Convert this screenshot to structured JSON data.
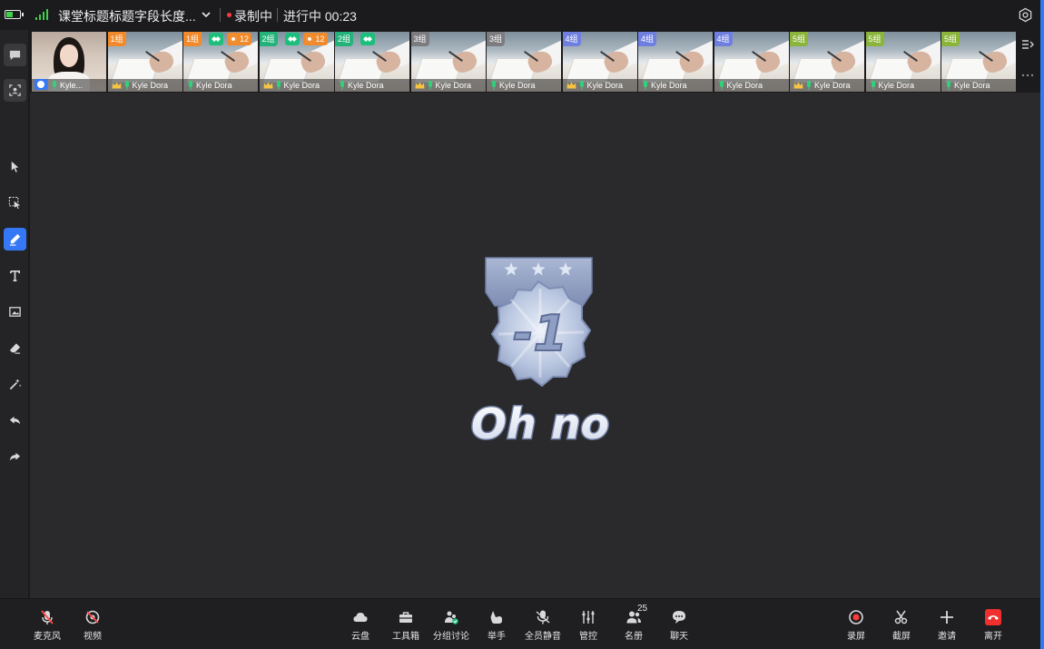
{
  "topbar": {
    "battery_level": 0.55,
    "title": "课堂标题标题字段长度...",
    "recording_label": "录制中",
    "progress_label": "进行中 00:23"
  },
  "colors": {
    "accent": "#3578f6",
    "signal": "#3fd14a",
    "recording": "#ff3b3b",
    "leave": "#f0302e"
  },
  "left_tools": [
    {
      "name": "chat-bubble-icon"
    },
    {
      "name": "face-frame-icon"
    },
    {
      "name": "pointer-icon"
    },
    {
      "name": "select-icon"
    },
    {
      "name": "pen-icon"
    },
    {
      "name": "text-icon"
    },
    {
      "name": "image-icon"
    },
    {
      "name": "eraser-icon"
    },
    {
      "name": "magic-wand-icon"
    },
    {
      "name": "undo-icon"
    },
    {
      "name": "redo-icon"
    }
  ],
  "video_strip": {
    "teacher": {
      "name": "Kyle..."
    },
    "students": [
      {
        "group": "1组",
        "group_color": "#f08a2a",
        "name": "Kyle Dora",
        "crown": true,
        "team": false,
        "medal": ""
      },
      {
        "group": "1组",
        "group_color": "#f08a2a",
        "name": "Kyle Dora",
        "crown": false,
        "team": true,
        "medal": "12"
      },
      {
        "group": "2组",
        "group_color": "#23b37a",
        "name": "Kyle Dora",
        "crown": true,
        "team": true,
        "medal": "12"
      },
      {
        "group": "2组",
        "group_color": "#23b37a",
        "name": "Kyle Dora",
        "crown": false,
        "team": true,
        "medal": ""
      },
      {
        "group": "3组",
        "group_color": "#7c7c80",
        "name": "Kyle Dora",
        "crown": true,
        "team": false,
        "medal": ""
      },
      {
        "group": "3组",
        "group_color": "#7c7c80",
        "name": "Kyle Dora",
        "crown": false,
        "team": false,
        "medal": ""
      },
      {
        "group": "4组",
        "group_color": "#6f7fe0",
        "name": "Kyle Dora",
        "crown": true,
        "team": false,
        "medal": ""
      },
      {
        "group": "4组",
        "group_color": "#6f7fe0",
        "name": "Kyle Dora",
        "crown": false,
        "team": false,
        "medal": ""
      },
      {
        "group": "4组",
        "group_color": "#6f7fe0",
        "name": "Kyle Dora",
        "crown": false,
        "team": false,
        "medal": ""
      },
      {
        "group": "5组",
        "group_color": "#8ab43a",
        "name": "Kyle Dora",
        "crown": true,
        "team": false,
        "medal": ""
      },
      {
        "group": "5组",
        "group_color": "#8ab43a",
        "name": "Kyle Dora",
        "crown": false,
        "team": false,
        "medal": ""
      },
      {
        "group": "5组",
        "group_color": "#8ab43a",
        "name": "Kyle Dora",
        "crown": false,
        "team": false,
        "medal": ""
      }
    ]
  },
  "medal": {
    "value": "-1",
    "caption": "Oh no",
    "stars": 3
  },
  "bottombar": {
    "left": [
      {
        "name": "mic-button",
        "icon": "mic-off-icon",
        "label": "麦克风"
      },
      {
        "name": "video-button",
        "icon": "camera-off-icon",
        "label": "视频"
      }
    ],
    "center": [
      {
        "name": "cloud-drive-button",
        "icon": "cloud-icon",
        "label": "云盘"
      },
      {
        "name": "toolbox-button",
        "icon": "toolbox-icon",
        "label": "工具箱"
      },
      {
        "name": "group-discussion-button",
        "icon": "group-discussion-icon",
        "label": "分组讨论"
      },
      {
        "name": "raise-hand-button",
        "icon": "raise-hand-icon",
        "label": "举手"
      },
      {
        "name": "mute-all-button",
        "icon": "mute-all-icon",
        "label": "全员静音"
      },
      {
        "name": "control-button",
        "icon": "sliders-icon",
        "label": "管控"
      },
      {
        "name": "roster-button",
        "icon": "people-icon",
        "label": "名册",
        "count": "25"
      },
      {
        "name": "chat-button",
        "icon": "chat-icon",
        "label": "聊天"
      }
    ],
    "right": [
      {
        "name": "record-screen-button",
        "icon": "record-icon",
        "label": "录屏"
      },
      {
        "name": "screenshot-button",
        "icon": "scissors-icon",
        "label": "截屏"
      },
      {
        "name": "invite-button",
        "icon": "plus-icon",
        "label": "邀请"
      },
      {
        "name": "leave-button",
        "icon": "hangup-icon",
        "label": "离开"
      }
    ]
  }
}
